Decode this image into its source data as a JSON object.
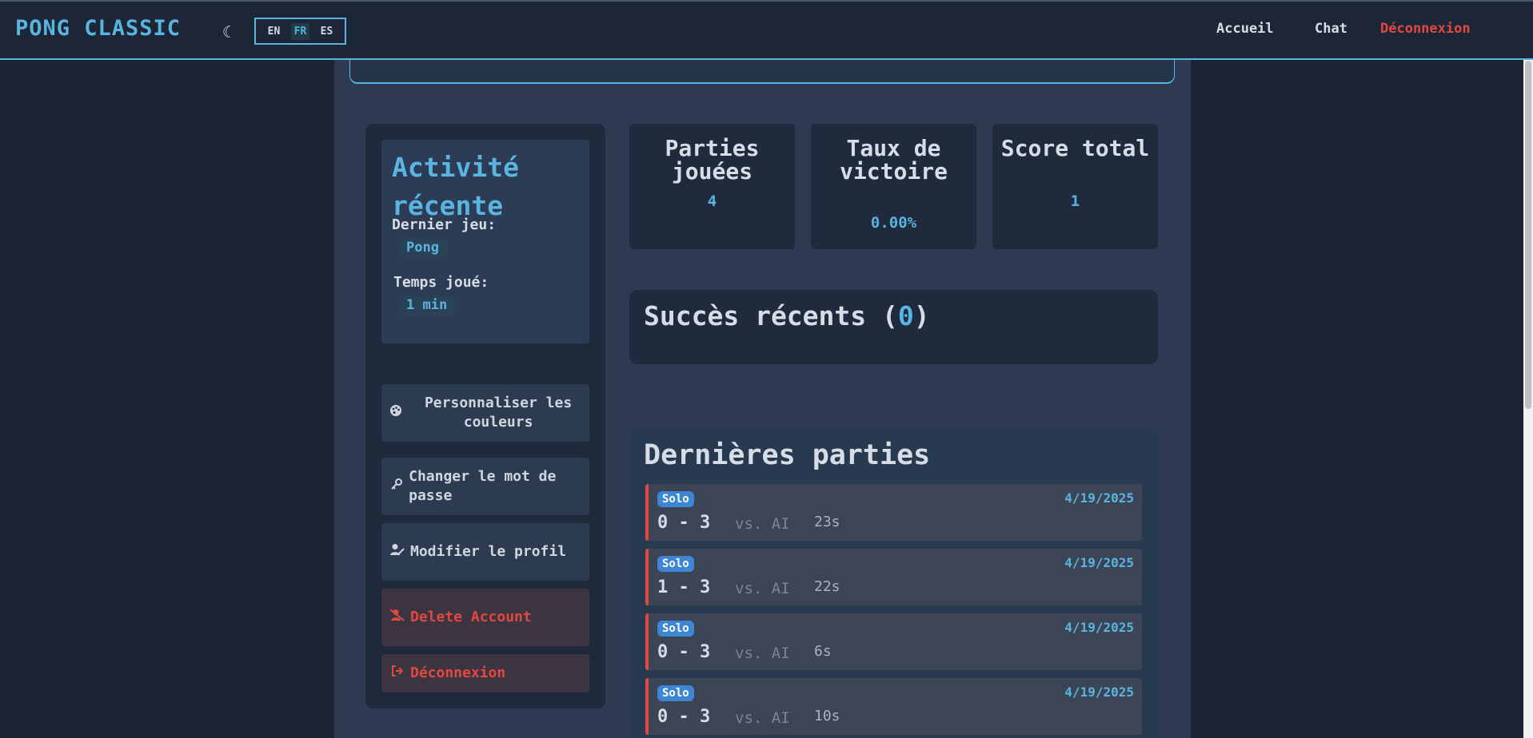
{
  "header": {
    "brand": "PONG CLASSIC",
    "theme_icon": "moon-icon",
    "languages": [
      "EN",
      "FR",
      "ES"
    ],
    "active_language": "FR",
    "nav": {
      "home": "Accueil",
      "chat": "Chat",
      "logout": "Déconnexion"
    }
  },
  "activity": {
    "title": "Activité récente",
    "last_game_label": "Dernier jeu:",
    "last_game_value": "Pong",
    "time_played_label": "Temps joué:",
    "time_played_value": "1 min"
  },
  "sidebar_actions": [
    {
      "label": "Personnaliser les couleurs",
      "icon": "palette-icon"
    },
    {
      "label": "Changer le mot de passe",
      "icon": "key-icon"
    },
    {
      "label": "Modifier le profil",
      "icon": "user-edit-icon"
    },
    {
      "label": "Delete Account",
      "icon": "user-delete-icon"
    },
    {
      "label": "Déconnexion",
      "icon": "sign-out-icon"
    }
  ],
  "stats": [
    {
      "label": "Parties jouées",
      "value": "4"
    },
    {
      "label": "Taux de victoire",
      "value": "0.00%"
    },
    {
      "label": "Score total",
      "value": "1"
    }
  ],
  "achievements": {
    "title": "Succès récents (",
    "count": "0",
    "close": ")"
  },
  "recent_games": {
    "title": "Dernières parties",
    "games": [
      {
        "mode": "Solo",
        "date": "4/19/2025",
        "score": "0 - 3",
        "opponent": "vs. AI",
        "duration": "23s"
      },
      {
        "mode": "Solo",
        "date": "4/19/2025",
        "score": "1 - 3",
        "opponent": "vs. AI",
        "duration": "22s"
      },
      {
        "mode": "Solo",
        "date": "4/19/2025",
        "score": "0 - 3",
        "opponent": "vs. AI",
        "duration": "6s"
      },
      {
        "mode": "Solo",
        "date": "4/19/2025",
        "score": "0 - 3",
        "opponent": "vs. AI",
        "duration": "10s"
      }
    ]
  },
  "colors": {
    "accent": "#5ab4e0",
    "danger": "#e2483f",
    "badge": "#3d86d4",
    "background": "#1b2433",
    "panel": "#2d3a51"
  }
}
